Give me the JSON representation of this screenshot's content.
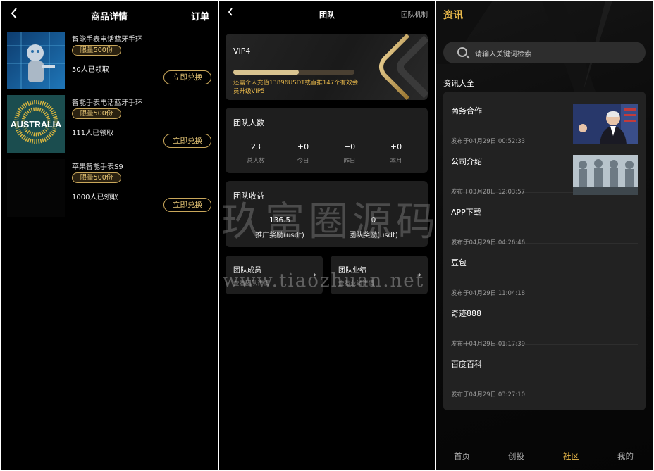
{
  "product_page": {
    "back_icon": "chevron-left-icon",
    "title": "商品详情",
    "orders_link": "订单",
    "products": [
      {
        "name": "智能手表电话蓝牙手环",
        "badge": "限量500份",
        "count": "50人已领取",
        "button": "立即兑换",
        "image": "robot-photo"
      },
      {
        "name": "智能手表电话蓝牙手环",
        "badge": "限量500份",
        "count": "111人已领取",
        "button": "立即兑换",
        "image": "australia-logo",
        "image_text": "AUSTRALIA"
      },
      {
        "name": "苹果智能手表S9",
        "badge": "限量500份",
        "count": "1000人已领取",
        "button": "立即兑换",
        "image": "blank"
      }
    ]
  },
  "team_page": {
    "back_icon": "chevron-left-icon",
    "title": "团队",
    "mechanism_link": "团队机制",
    "vip": {
      "level": "VIP4",
      "progress": 0.54,
      "note": "还需个人充值13896USDT或直推147个有效会员升级VIP5"
    },
    "team_count": {
      "title": "团队人数",
      "stats": [
        {
          "value": "23",
          "label": "总人数"
        },
        {
          "value": "+0",
          "label": "今日"
        },
        {
          "value": "+0",
          "label": "昨日"
        },
        {
          "value": "+0",
          "label": "本月"
        }
      ]
    },
    "team_earnings": {
      "title": "团队收益",
      "items": [
        {
          "value": "136.5",
          "label": "推广奖励(usdt)"
        },
        {
          "value": "0",
          "label": "团队奖励(usdt)"
        }
      ]
    },
    "members": {
      "title": "团队成员",
      "subtitle": "查看团队详情"
    },
    "performance": {
      "title": "团队业绩",
      "subtitle": "查看业绩详情"
    }
  },
  "news_page": {
    "title": "资讯",
    "search_placeholder": "请输入关键词检索",
    "section_title": "资讯大全",
    "items": [
      {
        "title": "商务合作",
        "date": "发布于04月29日 00:52:33",
        "thumb": "speaker-photo"
      },
      {
        "title": "公司介绍",
        "date": "发布于03月28日 12:03:57",
        "thumb": "robots-photo"
      },
      {
        "title": "APP下载",
        "date": "发布于04月29日 04:26:46"
      },
      {
        "title": "豆包",
        "date": "发布于04月29日 11:04:18"
      },
      {
        "title": "奇迹888",
        "date": "发布于04月29日 01:17:39"
      },
      {
        "title": "百度百科",
        "date": "发布于04月29日 03:27:10"
      }
    ],
    "tabs": [
      "首页",
      "创投",
      "社区",
      "我的"
    ],
    "active_tab": "社区"
  },
  "watermark": {
    "text": "玖富圈源码",
    "url": "www.tiaozhuan.net"
  },
  "colors": {
    "gold": "#e8b84a",
    "gold_border": "#c9a75b",
    "card_bg": "#1e1e1e"
  }
}
